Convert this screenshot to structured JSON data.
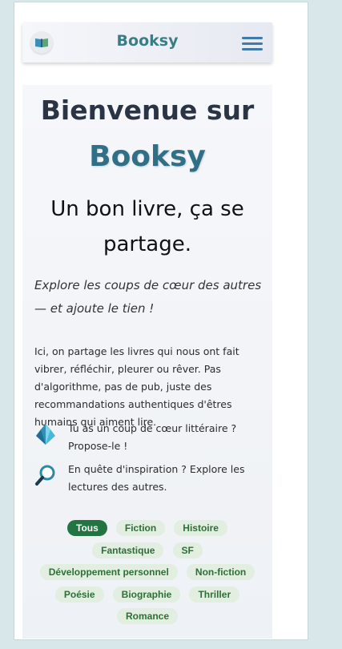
{
  "header": {
    "brand": "Booksy",
    "logo_icon": "open-book-icon",
    "menu_icon": "hamburger-menu-icon"
  },
  "hero": {
    "title_line1": "Bienvenue sur",
    "title_line2": "Booksy",
    "tagline": "Un bon livre, ça se partage.",
    "intro": "Explore les coups de cœur des autres — et ajoute le tien !",
    "description": "Ici, on partage les livres qui nous ont fait vibrer, réfléchir, pleurer ou rêver. Pas d'algorithme, pas de pub, juste des recommandations authentiques d'êtres humains qui aiment lire."
  },
  "features": [
    {
      "icon": "crystal-icon",
      "text": "Tu as un coup de cœur littéraire ? Propose-le !"
    },
    {
      "icon": "magnifier-icon",
      "text": "En quête d'inspiration ? Explore les lectures des autres."
    }
  ],
  "filters": {
    "active": "Tous",
    "tags": [
      "Tous",
      "Fiction",
      "Histoire",
      "Fantastique",
      "SF",
      "Développement personnel",
      "Non-fiction",
      "Poésie",
      "Biographie",
      "Thriller",
      "Romance"
    ]
  },
  "colors": {
    "brand": "#3b7d86",
    "active_tag": "#227541",
    "tag_bg": "#e1eee0"
  }
}
